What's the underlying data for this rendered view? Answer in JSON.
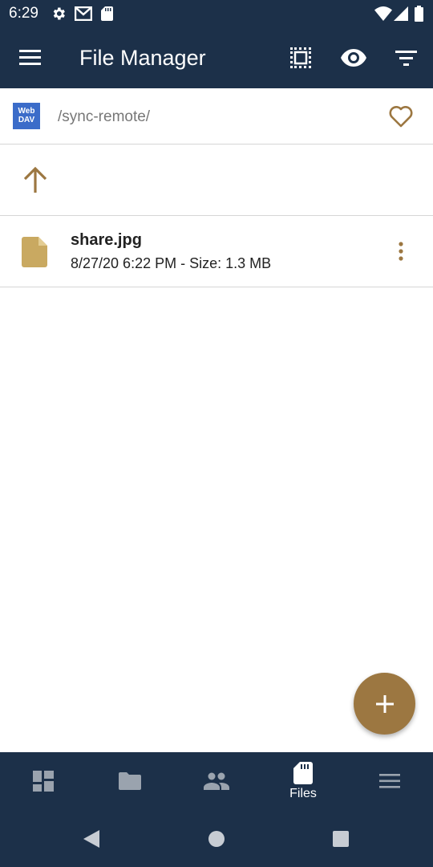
{
  "status_bar": {
    "time": "6:29",
    "icons": [
      "gear-icon",
      "gmail-icon",
      "sd-card-icon",
      "wifi-icon",
      "signal-icon",
      "battery-icon"
    ]
  },
  "app_bar": {
    "title": "File Manager",
    "actions": [
      "select-all-icon",
      "eye-icon",
      "filter-icon"
    ]
  },
  "path_bar": {
    "storage_badge_line1": "Web",
    "storage_badge_line2": "DAV",
    "path": "/sync-remote/"
  },
  "files": [
    {
      "name": "share.jpg",
      "meta": "8/27/20 6:22 PM - Size: 1.3 MB"
    }
  ],
  "bottom_nav": {
    "items": [
      {
        "icon": "dashboard-icon",
        "label": ""
      },
      {
        "icon": "folder-icon",
        "label": ""
      },
      {
        "icon": "people-icon",
        "label": ""
      },
      {
        "icon": "sd-card-icon",
        "label": "Files"
      },
      {
        "icon": "menu-icon",
        "label": ""
      }
    ],
    "active_index": 3
  },
  "colors": {
    "primary": "#1c3049",
    "accent": "#9c7741",
    "file_icon": "#c9a961",
    "webdav": "#3b6cc9"
  }
}
